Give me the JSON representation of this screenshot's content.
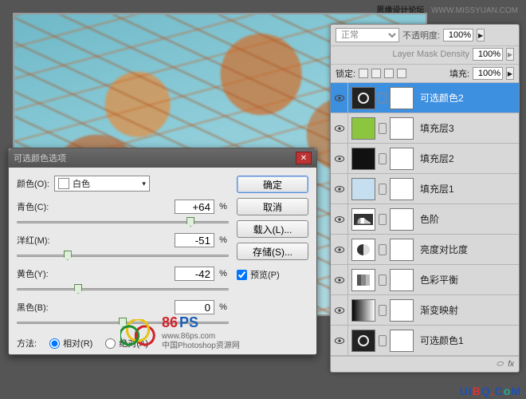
{
  "top": {
    "forum": "思缘设计论坛",
    "url": "WWW.MISSYUAN.COM"
  },
  "layers_panel": {
    "blend_mode": "正常",
    "opacity_label": "不透明度:",
    "opacity_value": "100%",
    "density_label": "Layer Mask Density",
    "density_value": "100%",
    "lock_label": "锁定:",
    "fill_label": "填充:",
    "fill_value": "100%",
    "layers": [
      {
        "name": "可选颜色2"
      },
      {
        "name": "填充层3"
      },
      {
        "name": "填充层2"
      },
      {
        "name": "填充层1"
      },
      {
        "name": "色阶"
      },
      {
        "name": "亮度对比度"
      },
      {
        "name": "色彩平衡"
      },
      {
        "name": "渐变映射"
      },
      {
        "name": "可选颜色1"
      }
    ],
    "footer_fx": "fx"
  },
  "dialog": {
    "title": "可选颜色选项",
    "color_label": "颜色(O):",
    "color_name": "白色",
    "sliders": {
      "cyan_label": "青色(C):",
      "cyan_value": "+64",
      "magenta_label": "洋红(M):",
      "magenta_value": "-51",
      "yellow_label": "黄色(Y):",
      "yellow_value": "-42",
      "black_label": "黑色(B):",
      "black_value": "0"
    },
    "pct": "%",
    "method_label": "方法:",
    "relative_label": "相对(R)",
    "absolute_label": "绝对(A)",
    "buttons": {
      "ok": "确定",
      "cancel": "取消",
      "load": "载入(L)...",
      "save": "存储(S)..."
    },
    "preview_label": "预览(P)"
  },
  "watermark": {
    "brand_num": "86",
    "brand_ps": "PS",
    "url": "www.86ps.com",
    "tagline": "中国Photoshop资源网"
  },
  "footer": {
    "text": "UiBQ.CoM"
  }
}
